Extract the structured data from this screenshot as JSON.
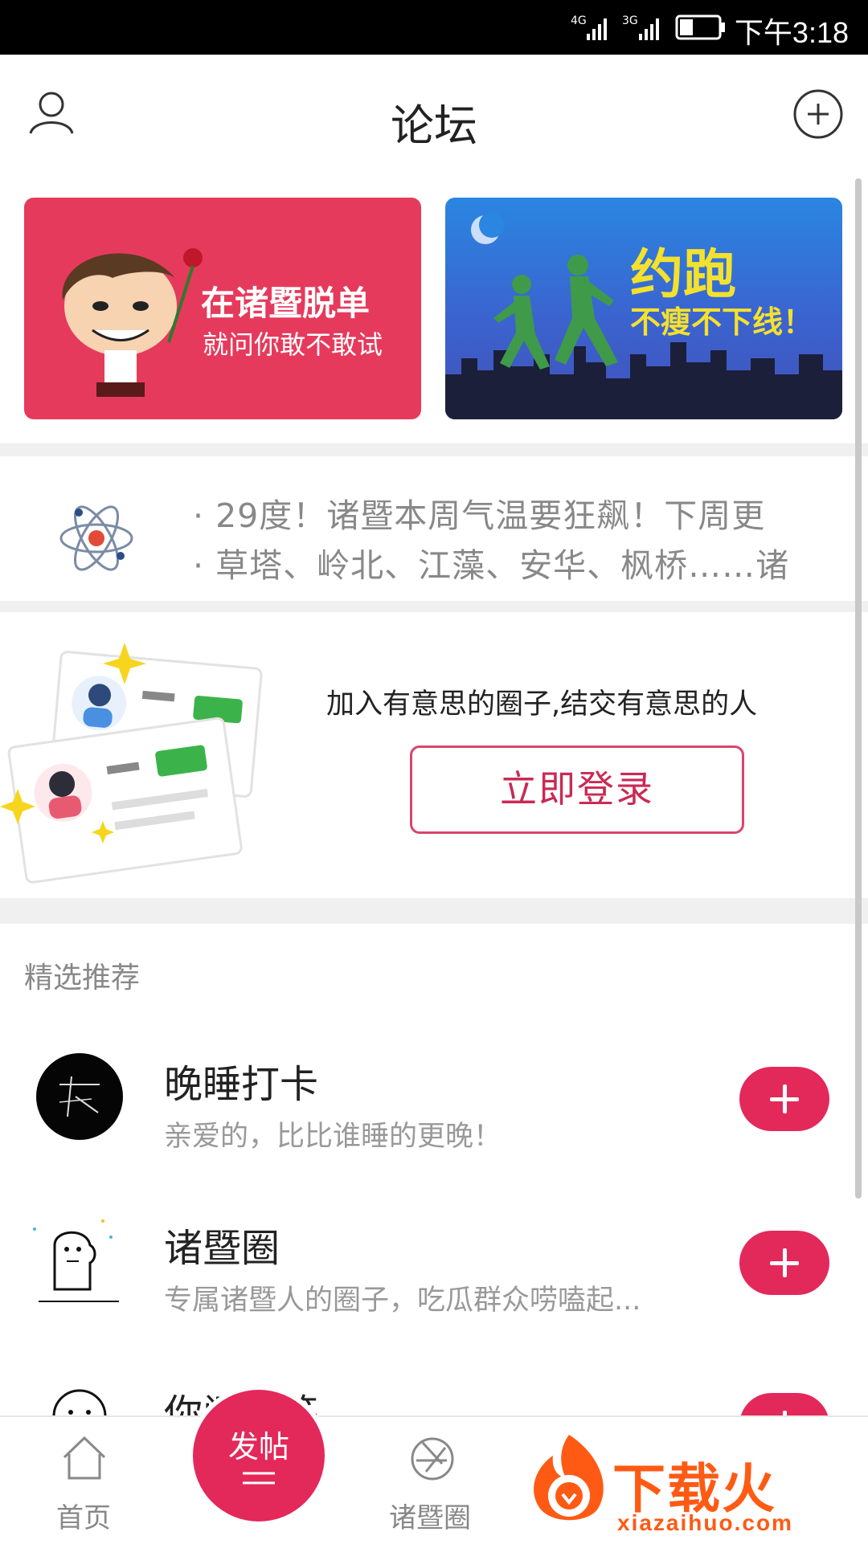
{
  "status_bar": {
    "signal1": "4G",
    "signal2": "3G",
    "time": "下午3:18"
  },
  "header": {
    "title": "论坛",
    "left_icon": "user-icon",
    "right_icon": "add-circle-icon"
  },
  "banners": [
    {
      "headline": "在诸暨脱单",
      "subline": "就问你敢不敢试",
      "bg_color": "#e63a5c"
    },
    {
      "headline": "约跑",
      "subline": "不瘦不下线！",
      "bg_color": "#2f6fd6"
    }
  ],
  "news": {
    "icon": "atom-icon",
    "items": [
      "· 29度！诸暨本周气温要狂飙！下周更",
      "· 草塔、岭北、江藻、安华、枫桥……诸"
    ]
  },
  "login_card": {
    "text": "加入有意思的圈子,结交有意思的人",
    "button_label": "立即登录"
  },
  "recommend": {
    "section_title": "精选推荐",
    "items": [
      {
        "name": "晚睡打卡",
        "desc": "亲爱的，比比谁睡的更晚！"
      },
      {
        "name": "诸暨圈",
        "desc": "专属诸暨人的圈子，吃瓜群众唠嗑起..."
      },
      {
        "name": "你问我答",
        "desc": ""
      }
    ]
  },
  "bottom_nav": {
    "home_label": "首页",
    "post_label": "发帖",
    "circle_label": "诸暨圈"
  },
  "watermark": {
    "brand": "下载火",
    "url": "xiazaihuo.com"
  },
  "colors": {
    "accent": "#e3285a",
    "login_border": "#d8456a"
  }
}
